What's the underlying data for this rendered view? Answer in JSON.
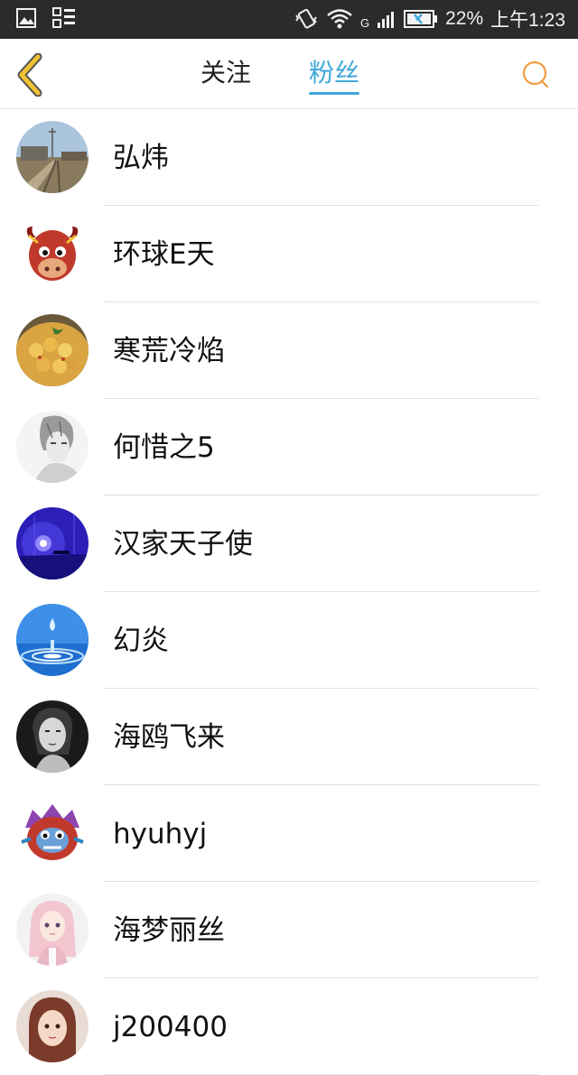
{
  "status_bar": {
    "battery": "22%",
    "time": "上午1:23",
    "network": "G"
  },
  "header": {
    "tabs": [
      {
        "label": "关注",
        "active": false
      },
      {
        "label": "粉丝",
        "active": true
      }
    ],
    "accent_color": "#3fa7d9",
    "back_color": "#f1c232",
    "search_color": "#f39a3d"
  },
  "fans": [
    {
      "name": "弘炜",
      "avatar": "photo-railway-avatar"
    },
    {
      "name": "环球E天",
      "avatar": "cartoon-bull-avatar"
    },
    {
      "name": "寒荒冷焰",
      "avatar": "food-dish-avatar"
    },
    {
      "name": "何惜之5",
      "avatar": "sketch-boy-avatar"
    },
    {
      "name": "汉家天子使",
      "avatar": "blue-night-avatar"
    },
    {
      "name": "幻炎",
      "avatar": "water-drop-avatar"
    },
    {
      "name": "海鸥飞来",
      "avatar": "woman-portrait-avatar"
    },
    {
      "name": "hyuhyj",
      "avatar": "cartoon-monster-avatar"
    },
    {
      "name": "海梦丽丝",
      "avatar": "anime-girl-avatar"
    },
    {
      "name": "j200400",
      "avatar": "girl-photo-avatar"
    }
  ]
}
